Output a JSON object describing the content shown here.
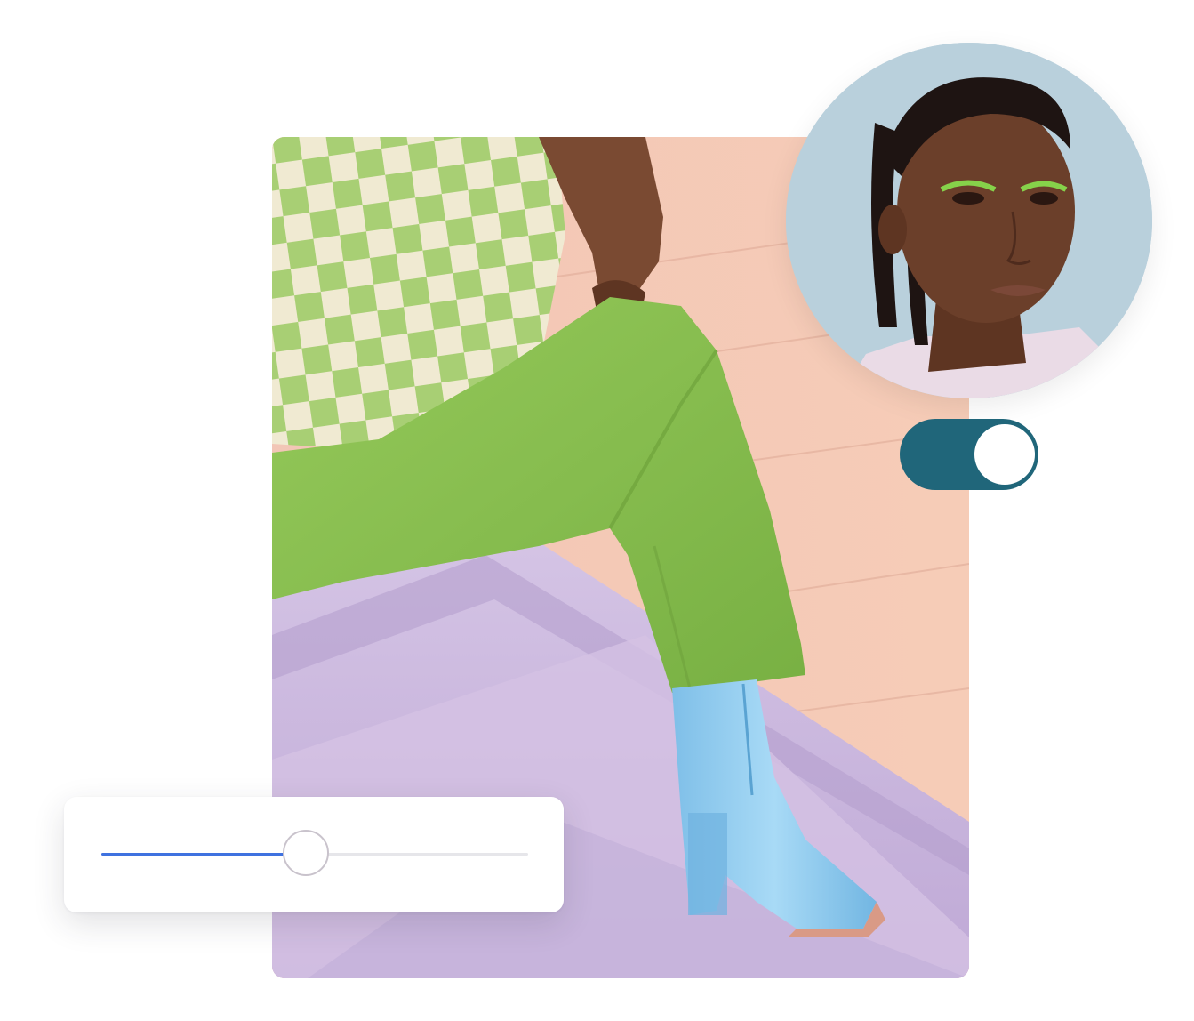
{
  "photo": {
    "description_icon": "fashion-photo-icon",
    "colors": {
      "wall": "#f3c7b4",
      "stairs": "#c9b6dc",
      "pants": "#86bd4f",
      "boot": "#8cc8ec",
      "sweater_light": "#f0ead2",
      "sweater_dark": "#a8cf74",
      "skin": "#7a4a32"
    }
  },
  "portrait": {
    "icon": "portrait-photo-icon",
    "colors": {
      "background": "#b9d0dc",
      "skin": "#6b3f2a",
      "hair": "#1e1412",
      "jacket": "#eadbe6",
      "eyeliner": "#86d24a"
    }
  },
  "toggle": {
    "state": "on",
    "colors": {
      "track": "#20667a",
      "knob": "#ffffff"
    }
  },
  "slider": {
    "value": 0.48,
    "colors": {
      "fill": "#3f72e0",
      "track": "#e6e6ea",
      "thumb_border": "#c9c3cc"
    }
  }
}
